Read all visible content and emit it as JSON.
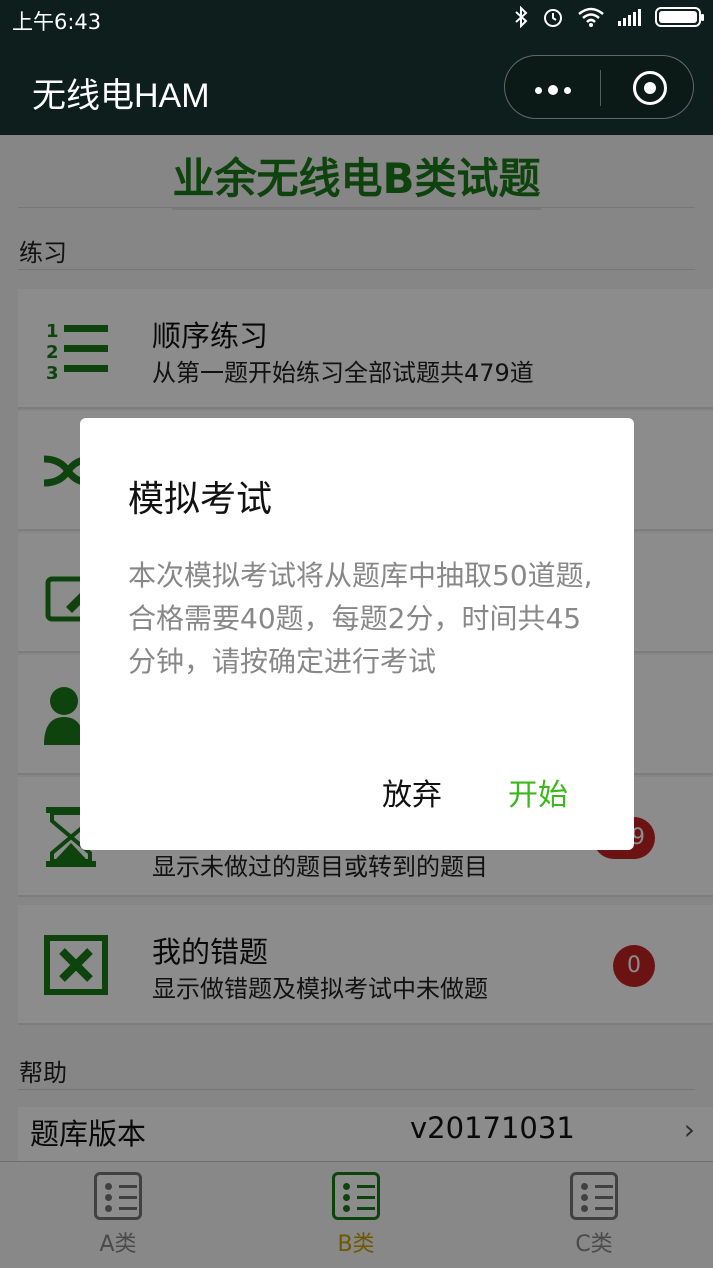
{
  "status_bar": {
    "time": "上午6:43",
    "icons": [
      "bluetooth-icon",
      "alarm-icon",
      "wifi-icon",
      "signal-icon",
      "battery-icon"
    ]
  },
  "nav": {
    "title": "无线电HAM",
    "menu_icon": "more-dots-icon",
    "close_icon": "target-icon"
  },
  "page": {
    "title": "业余无线电B类试题",
    "sections": {
      "practice": "练习",
      "help": "帮助"
    },
    "menu_items": [
      {
        "label": "顺序练习",
        "desc": "从第一题开始练习全部试题共479道",
        "icon": "numbered-list-icon"
      },
      {
        "label": "",
        "desc": "",
        "icon": "shuffle-icon"
      },
      {
        "label": "",
        "desc": "",
        "icon": "edit-icon"
      },
      {
        "label": "",
        "desc": "",
        "icon": "user-icon"
      },
      {
        "label": "",
        "desc": "显示未做过的题目或转到的题目",
        "icon": "hourglass-icon",
        "badge": "479"
      },
      {
        "label": "我的错题",
        "desc": "显示做错题及模拟考试中未做题",
        "icon": "error-box-icon",
        "badge": "0"
      }
    ],
    "version_row": {
      "label": "题库版本",
      "value": "v20171031",
      "chevron": "›"
    }
  },
  "tabbar": {
    "tabs": [
      {
        "label": "A类",
        "active": false
      },
      {
        "label": "B类",
        "active": true
      },
      {
        "label": "C类",
        "active": false
      }
    ]
  },
  "dialog": {
    "title": "模拟考试",
    "body": "本次模拟考试将从题库中抽取50道题,合格需要40题，每题2分，时间共45分钟，请按确定进行考试",
    "cancel_label": "放弃",
    "confirm_label": "开始"
  },
  "colors": {
    "primary_green": "#1a7a1a",
    "confirm_green": "#3cb81c",
    "badge_red": "#c42222",
    "nav_bg": "#0d1e1c"
  }
}
